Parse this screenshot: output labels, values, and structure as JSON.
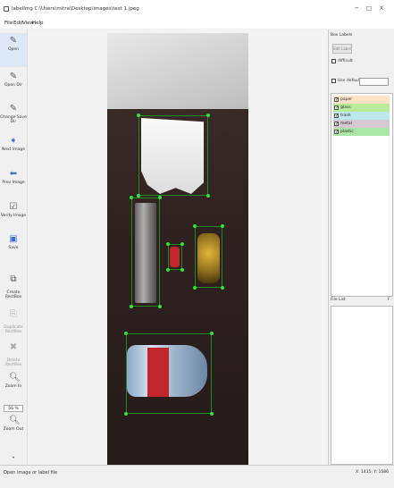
{
  "window": {
    "title": "labelImg C:\\Users\\mitra\\Desktop\\images\\test 1.jpeg",
    "minimize": "–",
    "maximize": "☐",
    "close": "X"
  },
  "menu": [
    "File",
    "Edit",
    "View",
    "Help"
  ],
  "toolbar": {
    "open": "Open",
    "open_dir": "Open Dir",
    "change_save_dir": "Change Save Dir",
    "next_image": "Next Image",
    "prev_image": "Prev Image",
    "verify_image": "Verify Image",
    "save": "Save",
    "create_rectbox": "Create\nRectBox",
    "duplicate_rectbox": "Duplicate\nRectBox",
    "delete_rectbox": "Delete\nRectBox",
    "zoom_in": "Zoom In",
    "zoom_value": "56 %",
    "zoom_out": "Zoom Out"
  },
  "box_labels_panel": {
    "header": "Box Labels",
    "edit_label": "Edit Label",
    "difficult": "difficult",
    "use_default_label": "Use default label",
    "labels": [
      {
        "name": "paper",
        "color": "#fde3c3"
      },
      {
        "name": "glass",
        "color": "#b9ec9a"
      },
      {
        "name": "trash",
        "color": "#bfe7f0"
      },
      {
        "name": "metal",
        "color": "#d6c8d3"
      },
      {
        "name": "plastic",
        "color": "#a9e6a5"
      }
    ]
  },
  "file_list_panel": {
    "header": "File List",
    "close_glyph": "F"
  },
  "status": {
    "message": "Open image or label file",
    "coords": "X: 1415; Y: 1586"
  },
  "colors": {
    "bbox_line": "#1f8a1f",
    "vertex": "#30e630"
  }
}
